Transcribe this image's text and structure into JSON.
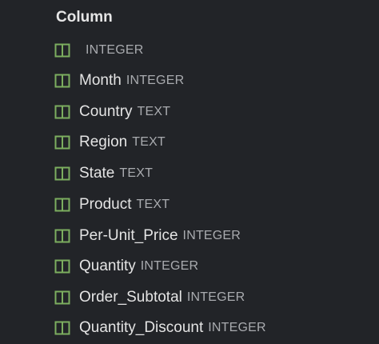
{
  "header": {
    "title": "Column"
  },
  "icon_color": "#7cae5f",
  "columns": [
    {
      "name": "",
      "type": "INTEGER",
      "icon": "table-column-icon"
    },
    {
      "name": "Month",
      "type": "INTEGER",
      "icon": "table-column-icon"
    },
    {
      "name": "Country",
      "type": "TEXT",
      "icon": "table-column-icon"
    },
    {
      "name": "Region",
      "type": "TEXT",
      "icon": "table-column-icon"
    },
    {
      "name": "State",
      "type": "TEXT",
      "icon": "table-column-icon"
    },
    {
      "name": "Product",
      "type": "TEXT",
      "icon": "table-column-icon"
    },
    {
      "name": "Per-Unit_Price",
      "type": "INTEGER",
      "icon": "table-column-icon"
    },
    {
      "name": "Quantity",
      "type": "INTEGER",
      "icon": "table-column-icon"
    },
    {
      "name": "Order_Subtotal",
      "type": "INTEGER",
      "icon": "table-column-icon"
    },
    {
      "name": "Quantity_Discount",
      "type": "INTEGER",
      "icon": "table-column-icon"
    }
  ]
}
